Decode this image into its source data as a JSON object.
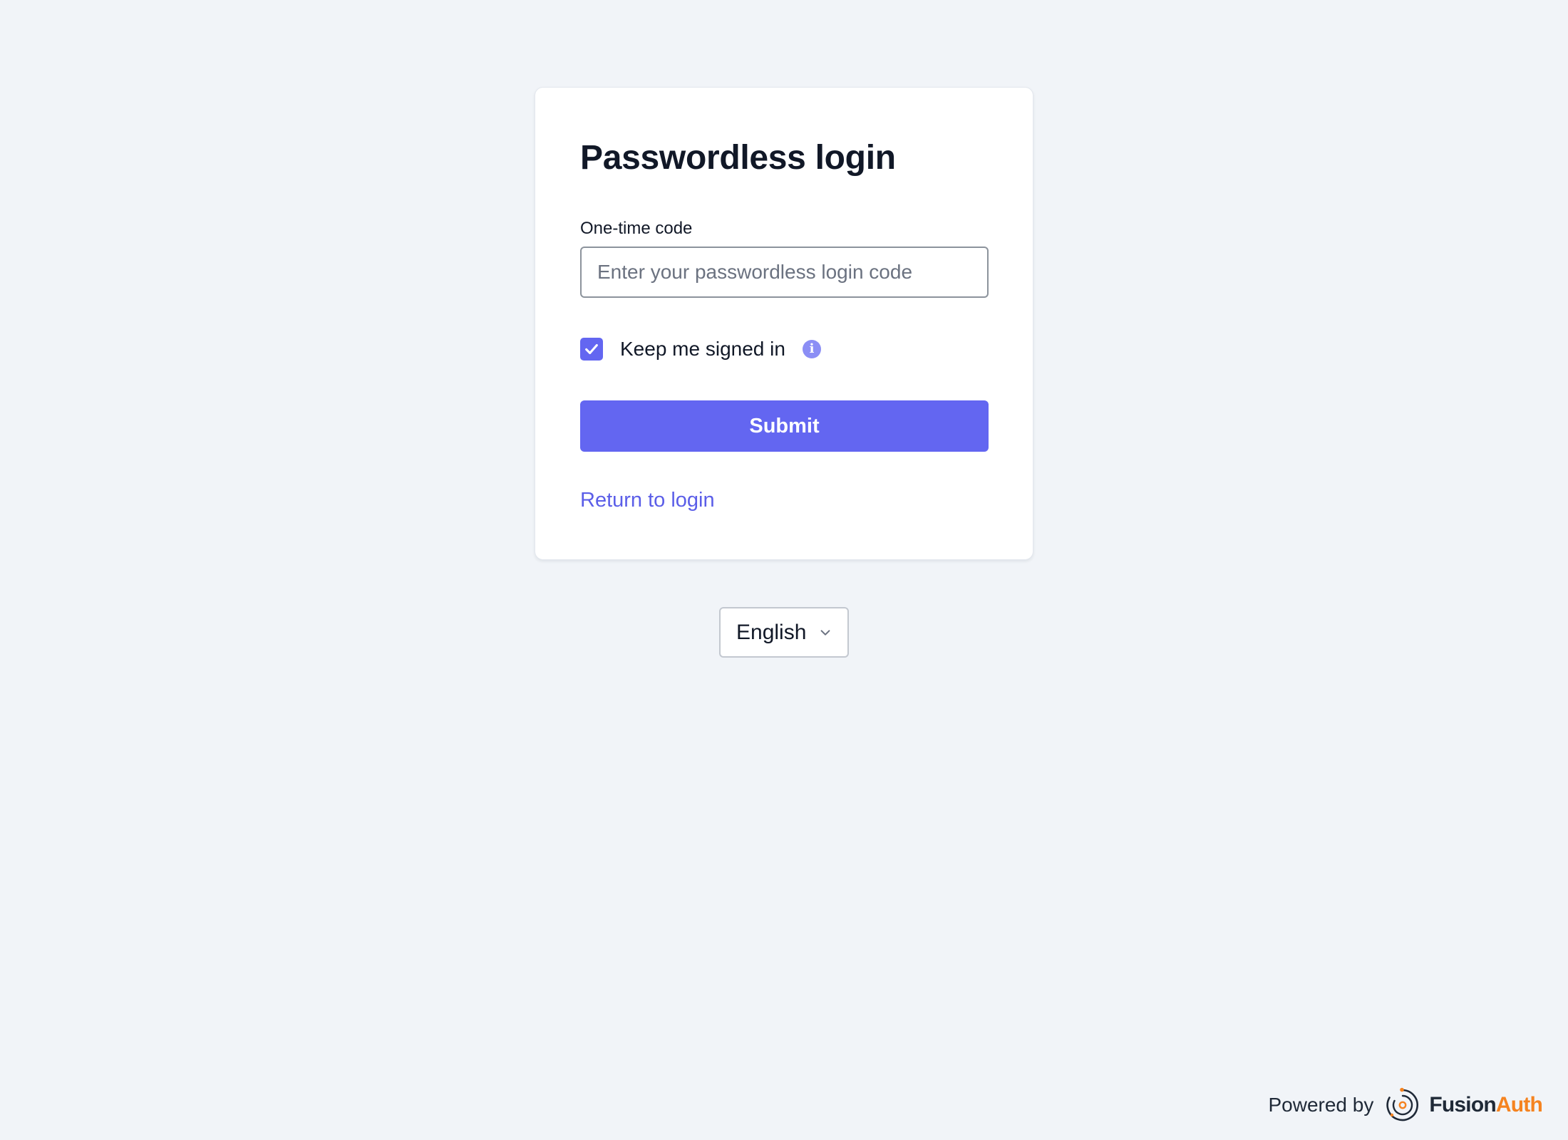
{
  "card": {
    "title": "Passwordless login",
    "code_field": {
      "label": "One-time code",
      "placeholder": "Enter your passwordless login code",
      "value": ""
    },
    "keep_signed_in": {
      "label": "Keep me signed in",
      "checked": true,
      "info_icon": "info-icon"
    },
    "submit_label": "Submit",
    "return_link": "Return to login"
  },
  "language_select": {
    "selected": "English",
    "icon": "chevron-down-icon"
  },
  "footer": {
    "powered_by": "Powered by",
    "brand_part1": "Fusion",
    "brand_part2": "Auth"
  },
  "colors": {
    "accent": "#6366f1",
    "background": "#f1f4f8",
    "brand_orange": "#f58320"
  }
}
